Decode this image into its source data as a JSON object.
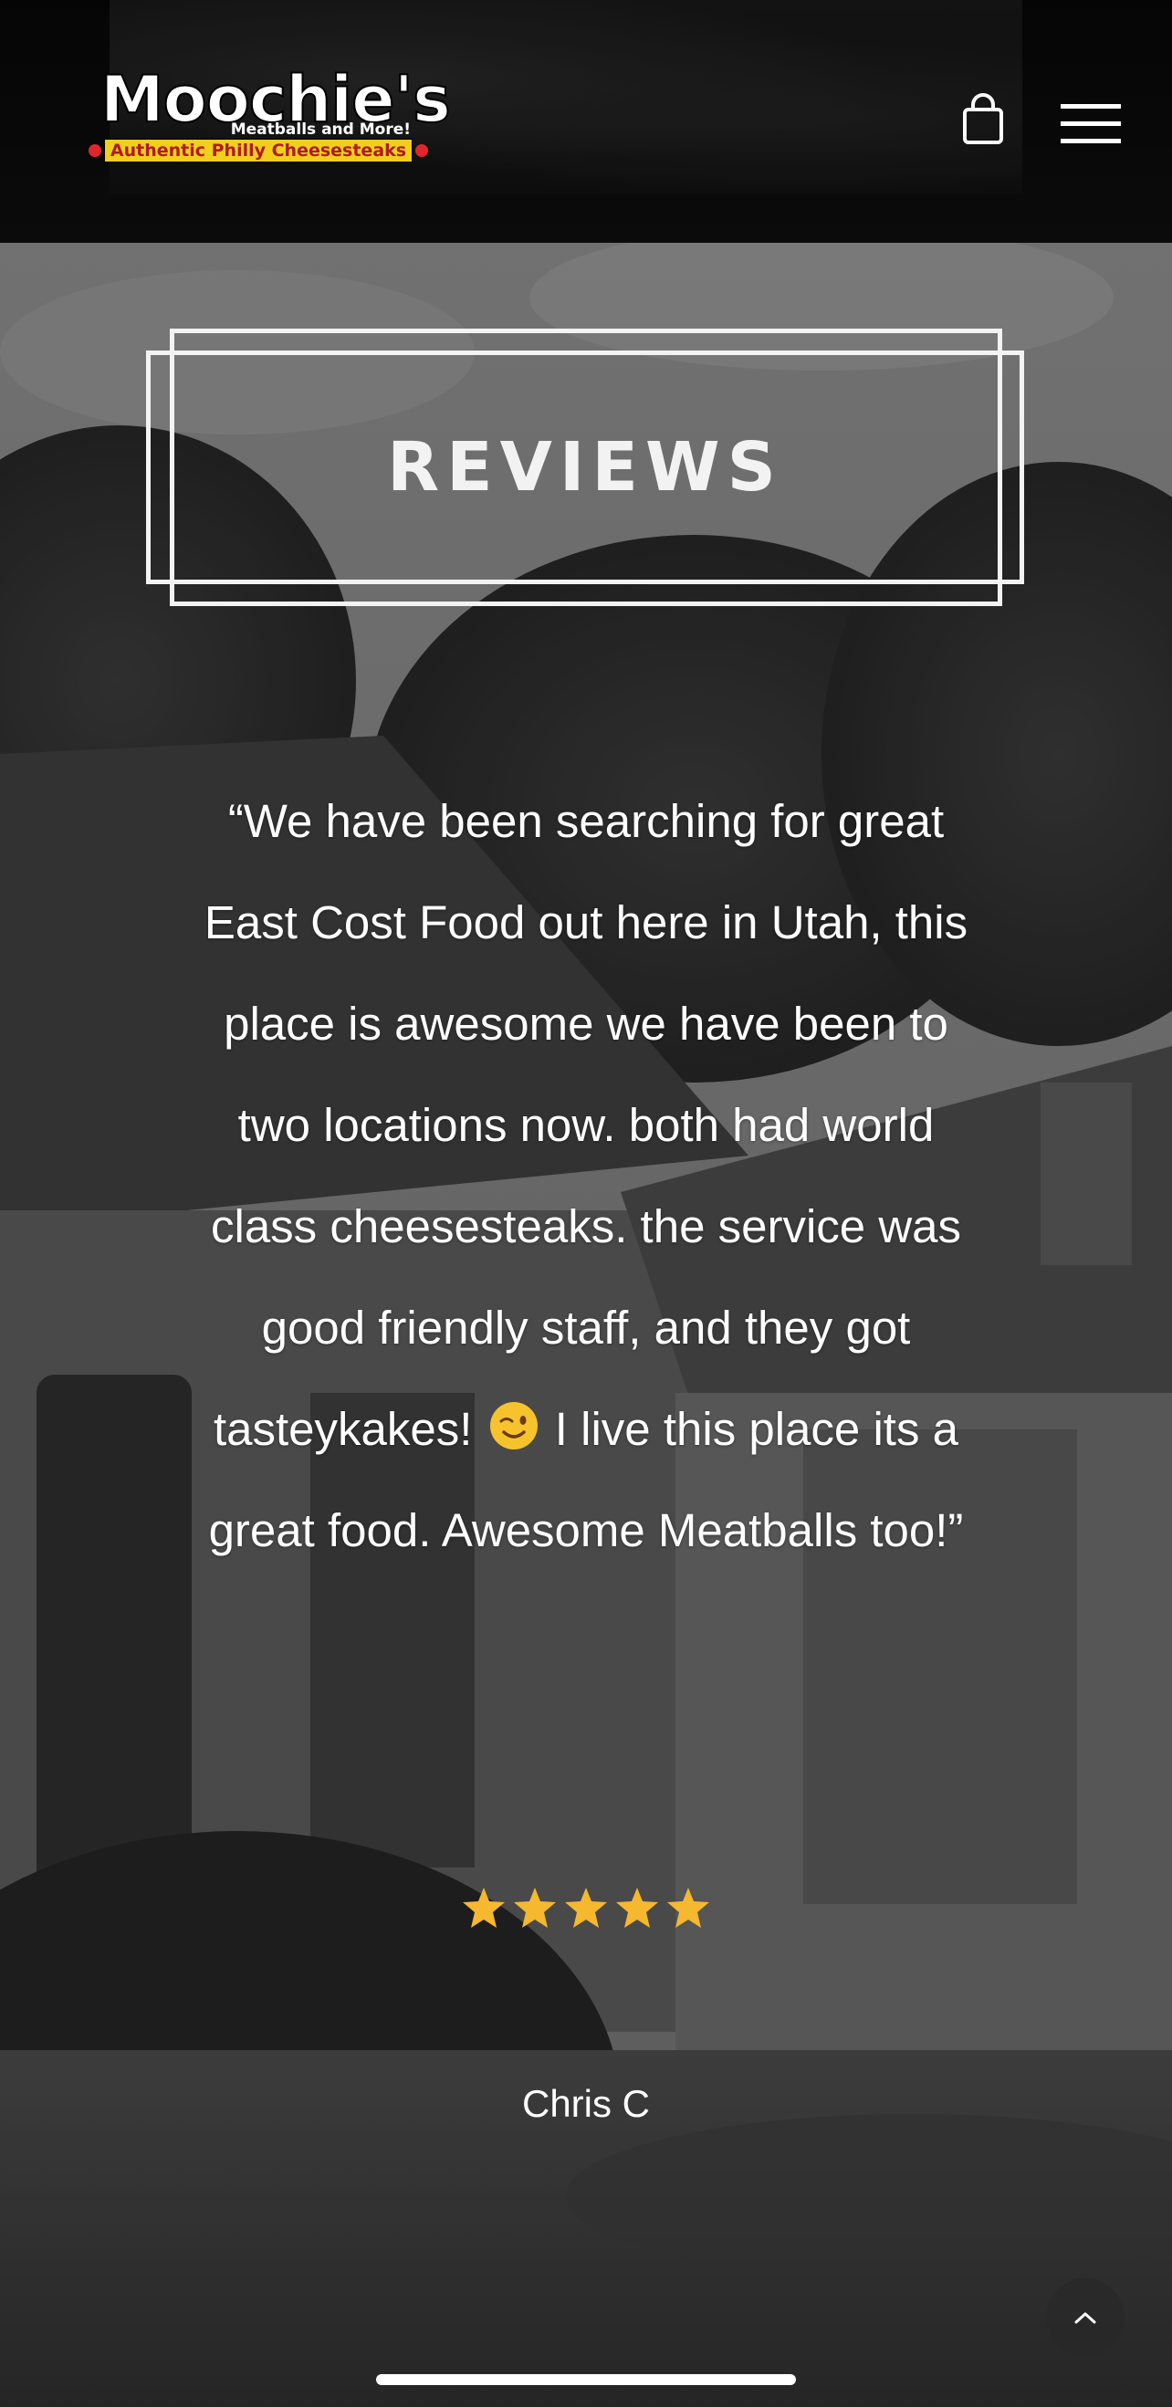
{
  "header": {
    "logo": {
      "title": "Moochie's",
      "subtitle": "Meatballs and More!",
      "tagline": "Authentic Philly Cheesesteaks"
    },
    "cart_icon": "shopping-bag-icon",
    "menu_icon": "hamburger-menu-icon"
  },
  "section": {
    "title": "REVIEWS"
  },
  "review": {
    "text_part1": "“We have been searching for great East Cost Food out here in Utah, this place is awesome we have been to two locations now. both had world class cheesesteaks. the service was good friendly staff, and they got tasteykakes!",
    "emoji": "winking-face-icon",
    "text_part2": "I live this place its a great food. Awesome Meatballs too!”",
    "rating": 5,
    "rating_max": 5,
    "author": "Chris C"
  },
  "controls": {
    "scroll_top_icon": "chevron-up-icon"
  },
  "colors": {
    "star": "#f5b82e",
    "logo_tag_bg": "#f2cf1d",
    "logo_tag_text": "#b11b1e",
    "text": "#ffffff"
  }
}
